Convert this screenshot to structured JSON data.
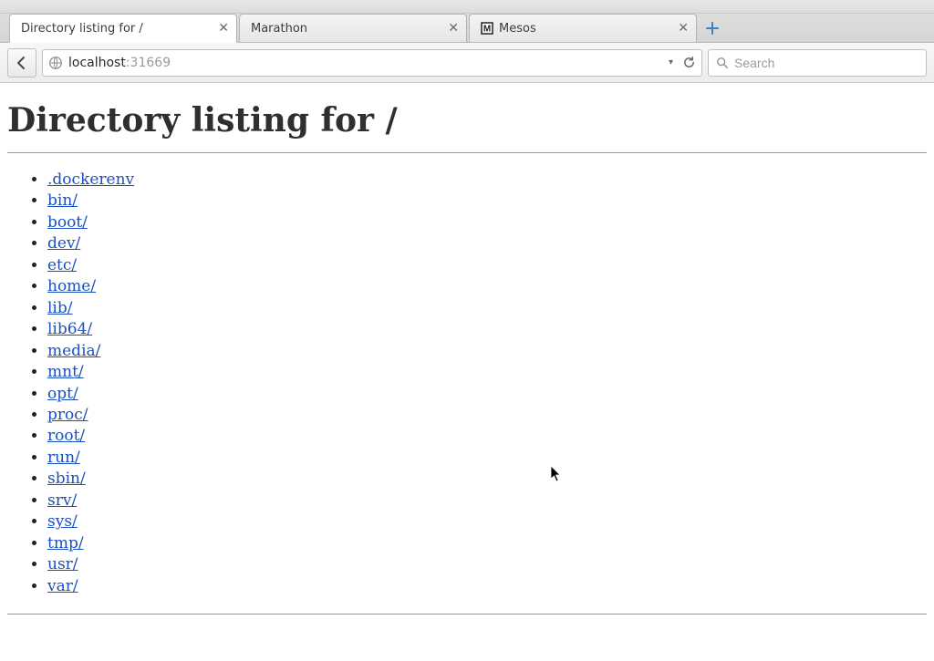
{
  "browser": {
    "tabs": [
      {
        "label": "Directory listing for /",
        "active": true,
        "favicon": "none"
      },
      {
        "label": "Marathon",
        "active": false,
        "favicon": "none"
      },
      {
        "label": "Mesos",
        "active": false,
        "favicon": "mesos"
      }
    ],
    "url": {
      "host": "localhost",
      "port": ":31669"
    },
    "search": {
      "placeholder": "Search"
    }
  },
  "page": {
    "heading": "Directory listing for /",
    "entries": [
      ".dockerenv",
      "bin/",
      "boot/",
      "dev/",
      "etc/",
      "home/",
      "lib/",
      "lib64/",
      "media/",
      "mnt/",
      "opt/",
      "proc/",
      "root/",
      "run/",
      "sbin/",
      "srv/",
      "sys/",
      "tmp/",
      "usr/",
      "var/"
    ]
  }
}
